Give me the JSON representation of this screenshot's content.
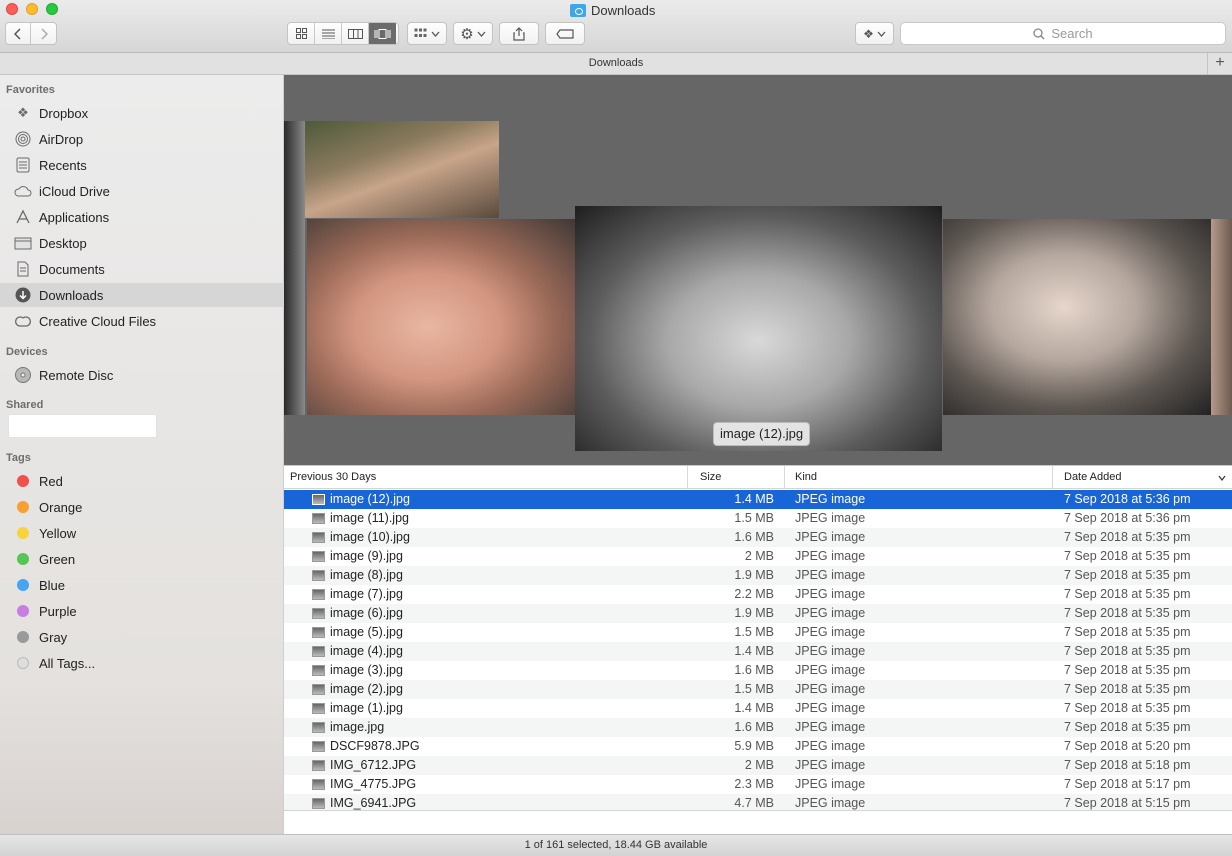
{
  "window": {
    "title": "Downloads",
    "path_label": "Downloads",
    "status": "1 of 161 selected, 18.44 GB available"
  },
  "toolbar": {
    "search_placeholder": "Search",
    "view_modes": [
      "icon-view",
      "list-view",
      "column-view",
      "cover-flow-view"
    ],
    "active_view": "cover-flow-view"
  },
  "sidebar": {
    "favorites_header": "Favorites",
    "favorites": [
      {
        "label": "Dropbox",
        "icon": "dropbox-icon"
      },
      {
        "label": "AirDrop",
        "icon": "airdrop-icon"
      },
      {
        "label": "Recents",
        "icon": "recents-icon"
      },
      {
        "label": "iCloud Drive",
        "icon": "cloud-icon"
      },
      {
        "label": "Applications",
        "icon": "applications-icon"
      },
      {
        "label": "Desktop",
        "icon": "desktop-icon"
      },
      {
        "label": "Documents",
        "icon": "document-icon"
      },
      {
        "label": "Downloads",
        "icon": "downloads-icon",
        "selected": true
      },
      {
        "label": "Creative Cloud Files",
        "icon": "creative-cloud-icon"
      }
    ],
    "devices_header": "Devices",
    "devices": [
      {
        "label": "Remote Disc",
        "icon": "disc-icon"
      }
    ],
    "shared_header": "Shared",
    "tags_header": "Tags",
    "tags": [
      {
        "label": "Red",
        "color": "#f0514d"
      },
      {
        "label": "Orange",
        "color": "#f5a030"
      },
      {
        "label": "Yellow",
        "color": "#f7d33c"
      },
      {
        "label": "Green",
        "color": "#55c655"
      },
      {
        "label": "Blue",
        "color": "#45a5f0"
      },
      {
        "label": "Purple",
        "color": "#c87ee0"
      },
      {
        "label": "Gray",
        "color": "#9a9a9a"
      },
      {
        "label": "All Tags...",
        "color": "#dedede"
      }
    ]
  },
  "coverflow": {
    "current_label": "image (12).jpg"
  },
  "list": {
    "columns": {
      "name": "Previous 30 Days",
      "size": "Size",
      "kind": "Kind",
      "date": "Date Added"
    },
    "rows": [
      {
        "name": "image (12).jpg",
        "size": "1.4 MB",
        "kind": "JPEG image",
        "date": "7 Sep 2018 at 5:36 pm",
        "selected": true
      },
      {
        "name": "image (11).jpg",
        "size": "1.5 MB",
        "kind": "JPEG image",
        "date": "7 Sep 2018 at 5:36 pm"
      },
      {
        "name": "image (10).jpg",
        "size": "1.6 MB",
        "kind": "JPEG image",
        "date": "7 Sep 2018 at 5:35 pm"
      },
      {
        "name": "image (9).jpg",
        "size": "2 MB",
        "kind": "JPEG image",
        "date": "7 Sep 2018 at 5:35 pm"
      },
      {
        "name": "image (8).jpg",
        "size": "1.9 MB",
        "kind": "JPEG image",
        "date": "7 Sep 2018 at 5:35 pm"
      },
      {
        "name": "image (7).jpg",
        "size": "2.2 MB",
        "kind": "JPEG image",
        "date": "7 Sep 2018 at 5:35 pm"
      },
      {
        "name": "image (6).jpg",
        "size": "1.9 MB",
        "kind": "JPEG image",
        "date": "7 Sep 2018 at 5:35 pm"
      },
      {
        "name": "image (5).jpg",
        "size": "1.5 MB",
        "kind": "JPEG image",
        "date": "7 Sep 2018 at 5:35 pm"
      },
      {
        "name": "image (4).jpg",
        "size": "1.4 MB",
        "kind": "JPEG image",
        "date": "7 Sep 2018 at 5:35 pm"
      },
      {
        "name": "image (3).jpg",
        "size": "1.6 MB",
        "kind": "JPEG image",
        "date": "7 Sep 2018 at 5:35 pm"
      },
      {
        "name": "image (2).jpg",
        "size": "1.5 MB",
        "kind": "JPEG image",
        "date": "7 Sep 2018 at 5:35 pm"
      },
      {
        "name": "image (1).jpg",
        "size": "1.4 MB",
        "kind": "JPEG image",
        "date": "7 Sep 2018 at 5:35 pm"
      },
      {
        "name": "image.jpg",
        "size": "1.6 MB",
        "kind": "JPEG image",
        "date": "7 Sep 2018 at 5:35 pm"
      },
      {
        "name": "DSCF9878.JPG",
        "size": "5.9 MB",
        "kind": "JPEG image",
        "date": "7 Sep 2018 at 5:20 pm"
      },
      {
        "name": "IMG_6712.JPG",
        "size": "2 MB",
        "kind": "JPEG image",
        "date": "7 Sep 2018 at 5:18 pm"
      },
      {
        "name": "IMG_4775.JPG",
        "size": "2.3 MB",
        "kind": "JPEG image",
        "date": "7 Sep 2018 at 5:17 pm"
      },
      {
        "name": "IMG_6941.JPG",
        "size": "4.7 MB",
        "kind": "JPEG image",
        "date": "7 Sep 2018 at 5:15 pm"
      }
    ]
  }
}
